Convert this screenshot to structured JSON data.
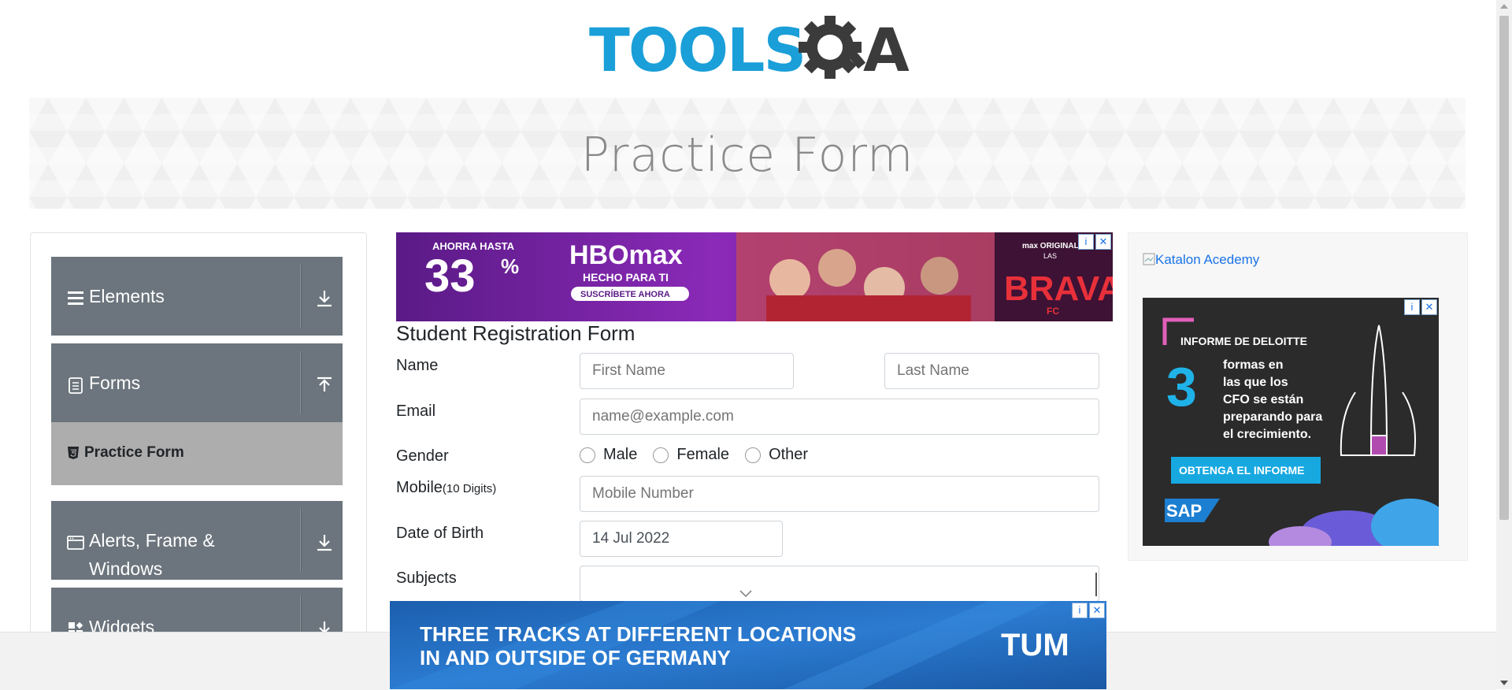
{
  "logo": {
    "text_part1": "TOOLS",
    "text_part2": "A",
    "accent_color": "#1a9fd8",
    "dark_color": "#3b3b3b"
  },
  "banner": {
    "title": "Practice Form"
  },
  "sidebar": {
    "groups": [
      {
        "label": "Elements",
        "icon": "menu-icon",
        "arrow": "download-icon"
      },
      {
        "label": "Forms",
        "icon": "document-icon",
        "arrow": "upload-icon"
      },
      {
        "label": "Alerts, Frame & Windows",
        "icon": "window-icon",
        "arrow": "download-icon"
      },
      {
        "label": "Widgets",
        "icon": "widgets-icon",
        "arrow": "download-icon"
      }
    ],
    "active_item": {
      "label": "Practice Form",
      "icon": "html5-icon"
    }
  },
  "ads": {
    "top": {
      "left_line1": "AHORRA HASTA",
      "percent": "33",
      "pct_sign": "%",
      "brand": "HBOmax",
      "tagline": "HECHO PARA TI",
      "cta": "SUSCRÍBETE AHORA",
      "right_small": "max ORIGINAL",
      "right_small2": "LAS",
      "right_big": "BRAVAS",
      "right_sub": "FC"
    },
    "right": {
      "line1": "INFORME DE DELOITTE",
      "number": "3",
      "lines": [
        "formas en",
        "las que los",
        "CFO se están",
        "preparando para",
        "el crecimiento."
      ],
      "cta": "OBTENGA EL INFORME",
      "brand": "SAP"
    },
    "bottom": {
      "line1": "THREE TRACKS AT DIFFERENT LOCATIONS",
      "line2": "IN AND OUTSIDE OF GERMANY",
      "brand": "TUM"
    },
    "info_symbol": "i",
    "close_symbol": "✕"
  },
  "katalon_link": "Katalon Acedemy",
  "form": {
    "title": "Student Registration Form",
    "name_label": "Name",
    "first_name_placeholder": "First Name",
    "last_name_placeholder": "Last Name",
    "email_label": "Email",
    "email_placeholder": "name@example.com",
    "gender_label": "Gender",
    "gender_options": [
      "Male",
      "Female",
      "Other"
    ],
    "mobile_label": "Mobile",
    "mobile_hint": "(10 Digits)",
    "mobile_placeholder": "Mobile Number",
    "dob_label": "Date of Birth",
    "dob_value": "14 Jul 2022",
    "subjects_label": "Subjects"
  }
}
